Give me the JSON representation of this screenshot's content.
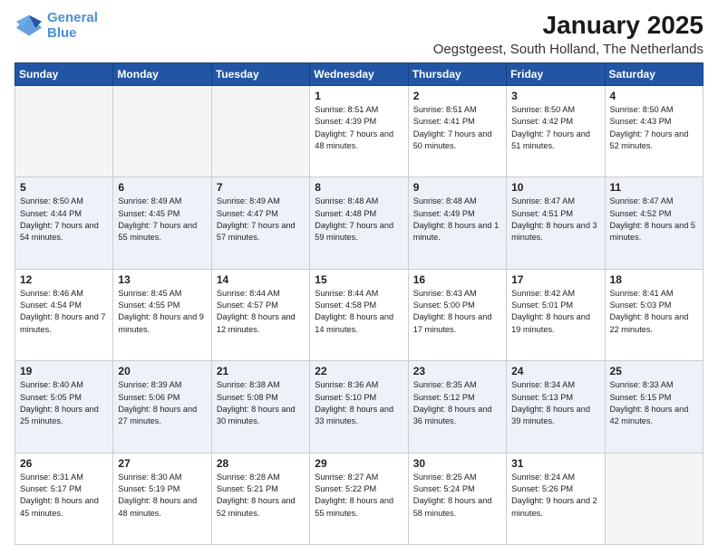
{
  "logo": {
    "line1": "General",
    "line2": "Blue"
  },
  "title": "January 2025",
  "subtitle": "Oegstgeest, South Holland, The Netherlands",
  "days": [
    "Sunday",
    "Monday",
    "Tuesday",
    "Wednesday",
    "Thursday",
    "Friday",
    "Saturday"
  ],
  "weeks": [
    {
      "cells": [
        {
          "day": null,
          "content": ""
        },
        {
          "day": null,
          "content": ""
        },
        {
          "day": null,
          "content": ""
        },
        {
          "day": "1",
          "sunrise": "8:51 AM",
          "sunset": "4:39 PM",
          "daylight": "7 hours and 48 minutes."
        },
        {
          "day": "2",
          "sunrise": "8:51 AM",
          "sunset": "4:41 PM",
          "daylight": "7 hours and 50 minutes."
        },
        {
          "day": "3",
          "sunrise": "8:50 AM",
          "sunset": "4:42 PM",
          "daylight": "7 hours and 51 minutes."
        },
        {
          "day": "4",
          "sunrise": "8:50 AM",
          "sunset": "4:43 PM",
          "daylight": "7 hours and 52 minutes."
        }
      ]
    },
    {
      "cells": [
        {
          "day": "5",
          "sunrise": "8:50 AM",
          "sunset": "4:44 PM",
          "daylight": "7 hours and 54 minutes."
        },
        {
          "day": "6",
          "sunrise": "8:49 AM",
          "sunset": "4:45 PM",
          "daylight": "7 hours and 55 minutes."
        },
        {
          "day": "7",
          "sunrise": "8:49 AM",
          "sunset": "4:47 PM",
          "daylight": "7 hours and 57 minutes."
        },
        {
          "day": "8",
          "sunrise": "8:48 AM",
          "sunset": "4:48 PM",
          "daylight": "7 hours and 59 minutes."
        },
        {
          "day": "9",
          "sunrise": "8:48 AM",
          "sunset": "4:49 PM",
          "daylight": "8 hours and 1 minute."
        },
        {
          "day": "10",
          "sunrise": "8:47 AM",
          "sunset": "4:51 PM",
          "daylight": "8 hours and 3 minutes."
        },
        {
          "day": "11",
          "sunrise": "8:47 AM",
          "sunset": "4:52 PM",
          "daylight": "8 hours and 5 minutes."
        }
      ]
    },
    {
      "cells": [
        {
          "day": "12",
          "sunrise": "8:46 AM",
          "sunset": "4:54 PM",
          "daylight": "8 hours and 7 minutes."
        },
        {
          "day": "13",
          "sunrise": "8:45 AM",
          "sunset": "4:55 PM",
          "daylight": "8 hours and 9 minutes."
        },
        {
          "day": "14",
          "sunrise": "8:44 AM",
          "sunset": "4:57 PM",
          "daylight": "8 hours and 12 minutes."
        },
        {
          "day": "15",
          "sunrise": "8:44 AM",
          "sunset": "4:58 PM",
          "daylight": "8 hours and 14 minutes."
        },
        {
          "day": "16",
          "sunrise": "8:43 AM",
          "sunset": "5:00 PM",
          "daylight": "8 hours and 17 minutes."
        },
        {
          "day": "17",
          "sunrise": "8:42 AM",
          "sunset": "5:01 PM",
          "daylight": "8 hours and 19 minutes."
        },
        {
          "day": "18",
          "sunrise": "8:41 AM",
          "sunset": "5:03 PM",
          "daylight": "8 hours and 22 minutes."
        }
      ]
    },
    {
      "cells": [
        {
          "day": "19",
          "sunrise": "8:40 AM",
          "sunset": "5:05 PM",
          "daylight": "8 hours and 25 minutes."
        },
        {
          "day": "20",
          "sunrise": "8:39 AM",
          "sunset": "5:06 PM",
          "daylight": "8 hours and 27 minutes."
        },
        {
          "day": "21",
          "sunrise": "8:38 AM",
          "sunset": "5:08 PM",
          "daylight": "8 hours and 30 minutes."
        },
        {
          "day": "22",
          "sunrise": "8:36 AM",
          "sunset": "5:10 PM",
          "daylight": "8 hours and 33 minutes."
        },
        {
          "day": "23",
          "sunrise": "8:35 AM",
          "sunset": "5:12 PM",
          "daylight": "8 hours and 36 minutes."
        },
        {
          "day": "24",
          "sunrise": "8:34 AM",
          "sunset": "5:13 PM",
          "daylight": "8 hours and 39 minutes."
        },
        {
          "day": "25",
          "sunrise": "8:33 AM",
          "sunset": "5:15 PM",
          "daylight": "8 hours and 42 minutes."
        }
      ]
    },
    {
      "cells": [
        {
          "day": "26",
          "sunrise": "8:31 AM",
          "sunset": "5:17 PM",
          "daylight": "8 hours and 45 minutes."
        },
        {
          "day": "27",
          "sunrise": "8:30 AM",
          "sunset": "5:19 PM",
          "daylight": "8 hours and 48 minutes."
        },
        {
          "day": "28",
          "sunrise": "8:28 AM",
          "sunset": "5:21 PM",
          "daylight": "8 hours and 52 minutes."
        },
        {
          "day": "29",
          "sunrise": "8:27 AM",
          "sunset": "5:22 PM",
          "daylight": "8 hours and 55 minutes."
        },
        {
          "day": "30",
          "sunrise": "8:25 AM",
          "sunset": "5:24 PM",
          "daylight": "8 hours and 58 minutes."
        },
        {
          "day": "31",
          "sunrise": "8:24 AM",
          "sunset": "5:26 PM",
          "daylight": "9 hours and 2 minutes."
        },
        {
          "day": null,
          "content": ""
        }
      ]
    }
  ]
}
